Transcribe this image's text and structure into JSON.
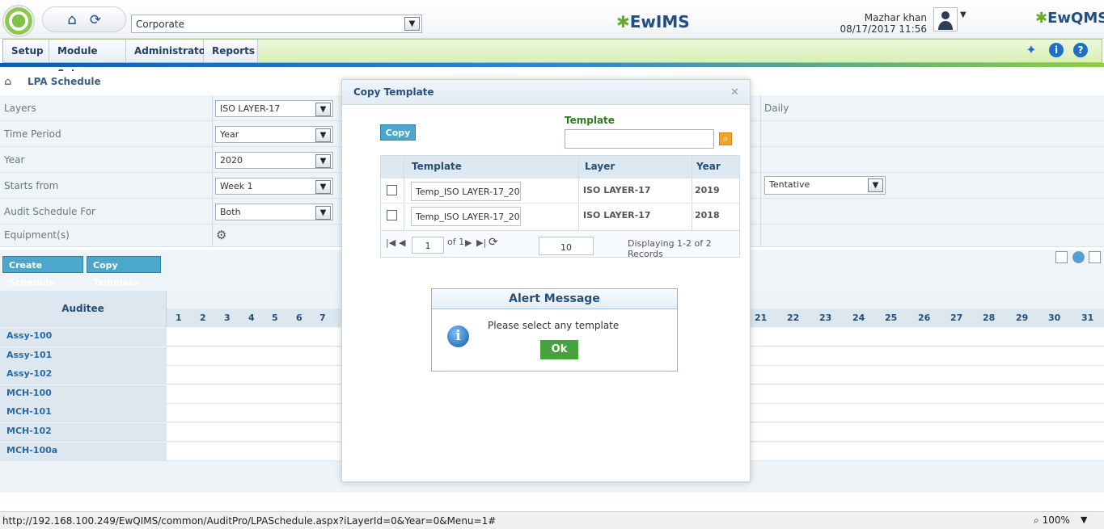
{
  "header": {
    "org_select_value": "Corporate",
    "center_logo": "EwIMS",
    "right_logo": "EwQMS",
    "user_name": "Mazhar khan",
    "user_datetime": "08/17/2017 11:56"
  },
  "menu": {
    "items": [
      "Setup",
      "Module Setup",
      "Administrator",
      "Reports"
    ]
  },
  "breadcrumb": {
    "title": "LPA Schedule"
  },
  "form": {
    "rows": [
      {
        "label": "Layers",
        "value": "ISO LAYER-17"
      },
      {
        "label": "Time Period",
        "value": "Year"
      },
      {
        "label": "Year",
        "value": "2020"
      },
      {
        "label": "Starts from",
        "value": "Week 1"
      },
      {
        "label": "Audit Schedule For",
        "value": "Both"
      },
      {
        "label": "Equipment(s)",
        "value": ""
      }
    ],
    "daily_label": "Daily",
    "tentative_value": "Tentative"
  },
  "actions": {
    "create": "Create Schedule",
    "copy_template": "Copy Template"
  },
  "calendar": {
    "auditee_header": "Auditee",
    "days_left": [
      "1",
      "2",
      "3",
      "4",
      "5",
      "6",
      "7"
    ],
    "days_right": [
      "21",
      "22",
      "23",
      "24",
      "25",
      "26",
      "27",
      "28",
      "29",
      "30",
      "31"
    ],
    "auditees": [
      "Assy-100",
      "Assy-101",
      "Assy-102",
      "MCH-100",
      "MCH-101",
      "MCH-102",
      "MCH-100a"
    ]
  },
  "dialog": {
    "title": "Copy Template",
    "copy_button": "Copy",
    "search_label": "Template",
    "search_value": "",
    "columns": [
      "Template",
      "Layer",
      "Year"
    ],
    "rows": [
      {
        "template": "Temp_ISO LAYER-17_20",
        "layer": "ISO LAYER-17",
        "year": "2019"
      },
      {
        "template": "Temp_ISO LAYER-17_20",
        "layer": "ISO LAYER-17",
        "year": "2018"
      }
    ],
    "pager": {
      "page": "1",
      "of": "of 1",
      "page_size": "10",
      "info": "Displaying 1-2 of 2 Records"
    }
  },
  "alert": {
    "title": "Alert Message",
    "message": "Please select any template",
    "ok": "Ok"
  },
  "status": {
    "url": "http://192.168.100.249/EwQIMS/common/AuditPro/LPASchedule.aspx?iLayerId=0&Year=0&Menu=1#",
    "zoom": "100%"
  }
}
